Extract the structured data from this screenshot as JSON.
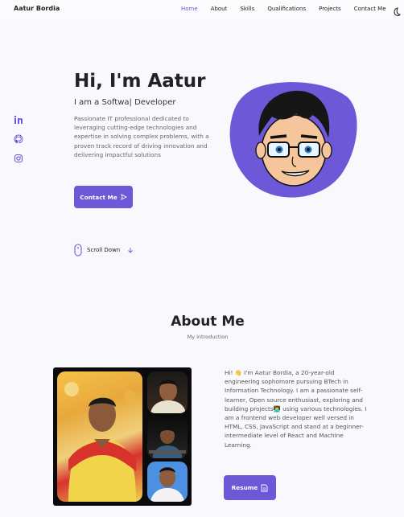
{
  "nav": {
    "brand": "Aatur Bordia",
    "links": [
      {
        "label": "Home",
        "active": true
      },
      {
        "label": "About"
      },
      {
        "label": "Skills"
      },
      {
        "label": "Qualifications"
      },
      {
        "label": "Projects"
      },
      {
        "label": "Contact Me"
      }
    ],
    "theme_icon": "moon-icon"
  },
  "hero": {
    "title": "Hi, I'm Aatur",
    "subtitle": "I am a Softwa| Developer",
    "description": "Passionate IT professional dedicated to leveraging cutting-edge technologies and expertise in solving complex problems, with a proven track record of driving innovation and delivering impactful solutions",
    "contact_button": "Contact Me",
    "scroll_label": "Scroll Down",
    "social_icons": [
      "linkedin-icon",
      "github-icon",
      "instagram-icon"
    ]
  },
  "about": {
    "title": "About Me",
    "subtitle": "My introduction",
    "text": "Hi! 👋 I'm Aatur Bordia, a 20-year-old engineering sophomore pursuing BTech in Information Technology. I am a passionate self-learner, Open source enthusiast, exploring and building projects👨‍💻 using various technologies. I am a frontend web developer well versed in HTML, CSS, JavaScript and stand at a beginner-intermediate level of React and Machine Learning.",
    "resume_button": "Resume"
  },
  "colors": {
    "accent": "#6d58d8",
    "background": "#f9f8fd"
  }
}
